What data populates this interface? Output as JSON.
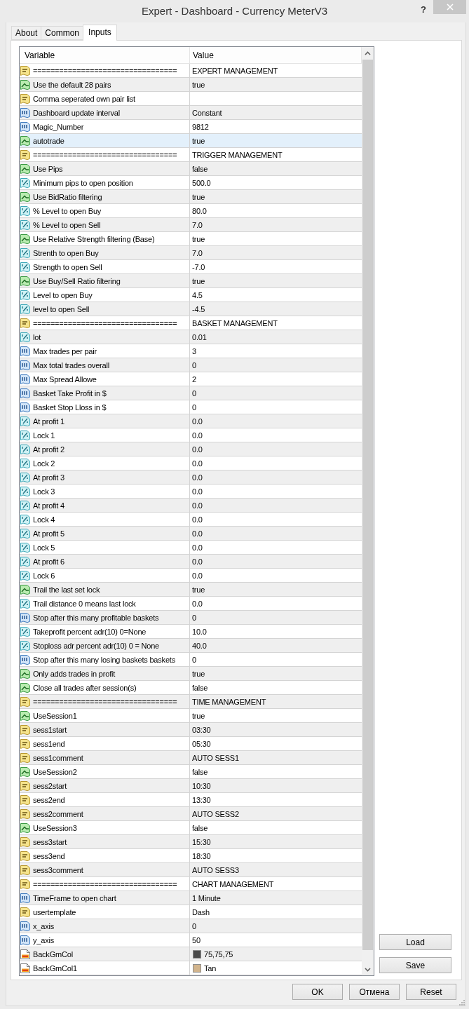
{
  "window": {
    "title": "Expert - Dashboard - Currency MeterV3",
    "help_button": "?"
  },
  "tabs": [
    {
      "label": "About",
      "selected": false
    },
    {
      "label": "Common",
      "selected": false
    },
    {
      "label": "Inputs",
      "selected": true
    }
  ],
  "table": {
    "columns": [
      "Variable",
      "Value"
    ],
    "rows": [
      {
        "kind": "string",
        "variable": "=================================",
        "value": "EXPERT MANAGEMENT",
        "selected": false
      },
      {
        "kind": "bool",
        "variable": "Use the default 28 pairs",
        "value": "true",
        "selected": false
      },
      {
        "kind": "string",
        "variable": "Comma seperated own pair list",
        "selected": false
      },
      {
        "kind": "int",
        "variable": "Dashboard update interval",
        "value": "Constant",
        "selected": false
      },
      {
        "kind": "int",
        "variable": "Magic_Number",
        "value": "9812",
        "selected": false
      },
      {
        "kind": "bool",
        "variable": "autotrade",
        "value": "true",
        "selected": true
      },
      {
        "kind": "string",
        "variable": "=================================",
        "value": "TRIGGER MANAGEMENT",
        "selected": false
      },
      {
        "kind": "bool",
        "variable": "Use Pips",
        "value": "false",
        "selected": false
      },
      {
        "kind": "double",
        "variable": "Minimum pips to open position",
        "value": "500.0",
        "selected": false
      },
      {
        "kind": "bool",
        "variable": "Use BidRatio filtering",
        "value": "true",
        "selected": false
      },
      {
        "kind": "double",
        "variable": "% Level to open Buy",
        "value": "80.0",
        "selected": false
      },
      {
        "kind": "double",
        "variable": "% Level to open Sell",
        "value": "7.0",
        "selected": false
      },
      {
        "kind": "bool",
        "variable": "Use Relative Strength filtering (Base)",
        "value": "true",
        "selected": false
      },
      {
        "kind": "double",
        "variable": "Strenth to open Buy",
        "value": "7.0",
        "selected": false
      },
      {
        "kind": "double",
        "variable": "Strength to open Sell",
        "value": "-7.0",
        "selected": false
      },
      {
        "kind": "bool",
        "variable": "Use Buy/Sell Ratio filtering",
        "value": "true",
        "selected": false
      },
      {
        "kind": "double",
        "variable": "Level to open Buy",
        "value": "4.5",
        "selected": false
      },
      {
        "kind": "double",
        "variable": "level to open Sell",
        "value": "-4.5",
        "selected": false
      },
      {
        "kind": "string",
        "variable": "=================================",
        "value": "BASKET MANAGEMENT",
        "selected": false
      },
      {
        "kind": "double",
        "variable": "lot",
        "value": "0.01",
        "selected": false
      },
      {
        "kind": "int",
        "variable": "Max trades per pair",
        "value": "3",
        "selected": false
      },
      {
        "kind": "int",
        "variable": "Max total trades overall",
        "value": "0",
        "selected": false
      },
      {
        "kind": "int",
        "variable": "Max Spread Allowe",
        "value": "2",
        "selected": false
      },
      {
        "kind": "int",
        "variable": "Basket Take Profit in $",
        "value": "0",
        "selected": false
      },
      {
        "kind": "int",
        "variable": "Basket Stop Lloss in $",
        "value": "0",
        "selected": false
      },
      {
        "kind": "double",
        "variable": "At profit 1",
        "value": "0.0",
        "selected": false
      },
      {
        "kind": "double",
        "variable": "Lock 1",
        "value": "0.0",
        "selected": false
      },
      {
        "kind": "double",
        "variable": "At profit 2",
        "value": "0.0",
        "selected": false
      },
      {
        "kind": "double",
        "variable": "Lock 2",
        "value": "0.0",
        "selected": false
      },
      {
        "kind": "double",
        "variable": "At profit 3",
        "value": "0.0",
        "selected": false
      },
      {
        "kind": "double",
        "variable": "Lock 3",
        "value": "0.0",
        "selected": false
      },
      {
        "kind": "double",
        "variable": "At profit 4",
        "value": "0.0",
        "selected": false
      },
      {
        "kind": "double",
        "variable": "Lock 4",
        "value": "0.0",
        "selected": false
      },
      {
        "kind": "double",
        "variable": "At profit 5",
        "value": "0.0",
        "selected": false
      },
      {
        "kind": "double",
        "variable": "Lock 5",
        "value": "0.0",
        "selected": false
      },
      {
        "kind": "double",
        "variable": "At profit 6",
        "value": "0.0",
        "selected": false
      },
      {
        "kind": "double",
        "variable": "Lock 6",
        "value": "0.0",
        "selected": false
      },
      {
        "kind": "bool",
        "variable": "Trail the last set lock",
        "value": "true",
        "selected": false
      },
      {
        "kind": "double",
        "variable": "Trail distance 0 means last lock",
        "value": "0.0",
        "selected": false
      },
      {
        "kind": "int",
        "variable": "Stop after this many profitable baskets",
        "value": "0",
        "selected": false
      },
      {
        "kind": "double",
        "variable": "Takeprofit percent adr(10) 0=None",
        "value": "10.0",
        "selected": false
      },
      {
        "kind": "double",
        "variable": "Stoploss adr percent adr(10) 0 = None",
        "value": "40.0",
        "selected": false
      },
      {
        "kind": "int",
        "variable": "Stop after this many losing baskets baskets",
        "value": "0",
        "selected": false
      },
      {
        "kind": "bool",
        "variable": "Only adds trades in profit",
        "value": "true",
        "selected": false
      },
      {
        "kind": "bool",
        "variable": "Close all trades after session(s)",
        "value": "false",
        "selected": false
      },
      {
        "kind": "string",
        "variable": "=================================",
        "value": "TIME MANAGEMENT",
        "selected": false
      },
      {
        "kind": "bool",
        "variable": "UseSession1",
        "value": "true",
        "selected": false
      },
      {
        "kind": "string",
        "variable": "sess1start",
        "value": "03:30",
        "selected": false
      },
      {
        "kind": "string",
        "variable": "sess1end",
        "value": "05:30",
        "selected": false
      },
      {
        "kind": "string",
        "variable": "sess1comment",
        "value": "AUTO SESS1",
        "selected": false
      },
      {
        "kind": "bool",
        "variable": "UseSession2",
        "value": "false",
        "selected": false
      },
      {
        "kind": "string",
        "variable": "sess2start",
        "value": "10:30",
        "selected": false
      },
      {
        "kind": "string",
        "variable": "sess2end",
        "value": "13:30",
        "selected": false
      },
      {
        "kind": "string",
        "variable": "sess2comment",
        "value": "AUTO SESS2",
        "selected": false
      },
      {
        "kind": "bool",
        "variable": "UseSession3",
        "value": "false",
        "selected": false
      },
      {
        "kind": "string",
        "variable": "sess3start",
        "value": "15:30",
        "selected": false
      },
      {
        "kind": "string",
        "variable": "sess3end",
        "value": "18:30",
        "selected": false
      },
      {
        "kind": "string",
        "variable": "sess3comment",
        "value": "AUTO SESS3",
        "selected": false
      },
      {
        "kind": "string",
        "variable": "=================================",
        "value": "CHART MANAGEMENT",
        "selected": false
      },
      {
        "kind": "int",
        "variable": "TimeFrame to open chart",
        "value": "1 Minute",
        "selected": false
      },
      {
        "kind": "string",
        "variable": "usertemplate",
        "value": "Dash",
        "selected": false
      },
      {
        "kind": "int",
        "variable": "x_axis",
        "value": "0",
        "selected": false
      },
      {
        "kind": "int",
        "variable": "y_axis",
        "value": "50",
        "selected": false
      },
      {
        "kind": "color",
        "variable": "BackGmCol",
        "value": "75,75,75",
        "color": "#4b4b4b",
        "selected": false
      },
      {
        "kind": "color",
        "variable": "BackGmCol1",
        "value": "Tan",
        "color": "#d2b48c",
        "selected": false
      }
    ]
  },
  "side_buttons": [
    "Load",
    "Save"
  ],
  "dialog_buttons": [
    "OK",
    "Отмена",
    "Reset"
  ]
}
